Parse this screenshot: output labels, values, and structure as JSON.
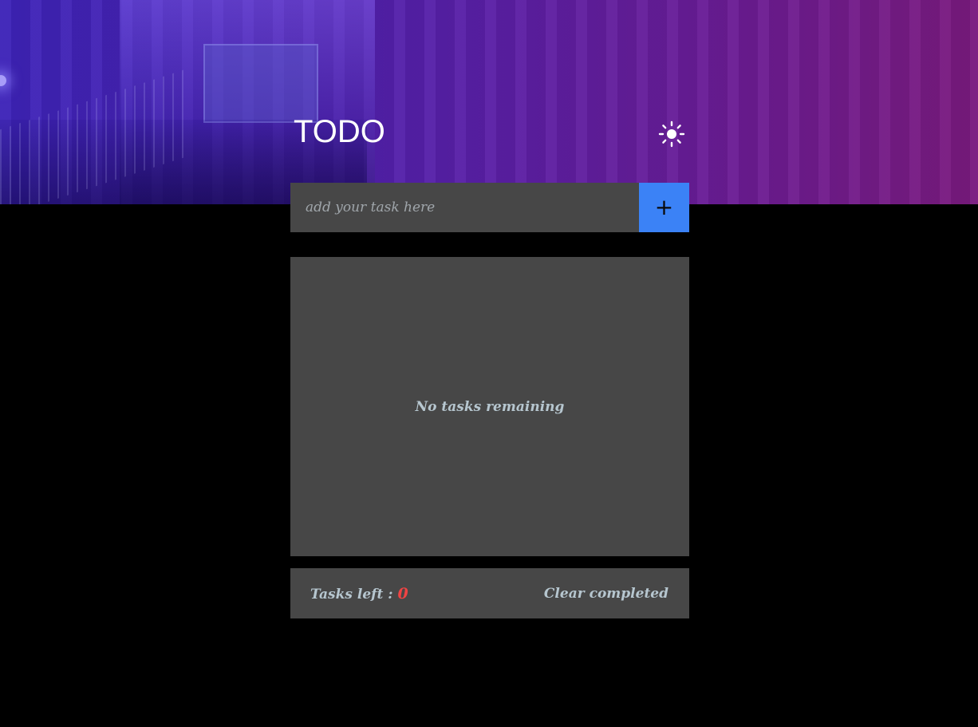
{
  "header": {
    "title": "TODO",
    "theme_icon": "sun-icon"
  },
  "add_form": {
    "placeholder": "add your task here",
    "value": "",
    "add_label": "+"
  },
  "task_list": {
    "empty_message": "No tasks remaining",
    "items": []
  },
  "footer": {
    "tasks_left_label": "Tasks left :",
    "tasks_left_count": "0",
    "clear_label": "Clear completed"
  },
  "colors": {
    "accent": "#3b82f6",
    "count": "#ef4444",
    "panel": "#474747",
    "muted_text": "#b6c6cf"
  }
}
